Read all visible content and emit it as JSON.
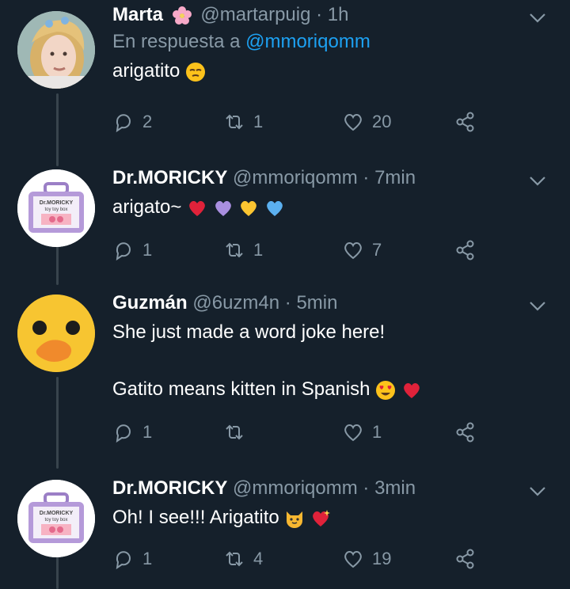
{
  "tweets": [
    {
      "name": "Marta",
      "name_emoji": "cherry-blossom",
      "handle": "@martarpuig",
      "time": "1h",
      "reply_prefix": "En respuesta a",
      "reply_mention": "@mmoriqomm",
      "text": "arigatito",
      "text_emoji": [
        "pensive-face"
      ],
      "replies": "2",
      "retweets": "1",
      "likes": "20"
    },
    {
      "name": "Dr.MORICKY",
      "handle": "@mmoriqomm",
      "time": "7min",
      "text": "arigato~",
      "text_emoji": [
        "red-heart",
        "purple-heart",
        "yellow-heart",
        "blue-heart"
      ],
      "replies": "1",
      "retweets": "1",
      "likes": "7"
    },
    {
      "name": "Guzmán",
      "handle": "@6uzm4n",
      "time": "5min",
      "text_lines": [
        "She just made a word joke here!",
        "Gatito means kitten in Spanish"
      ],
      "text_emoji": [
        "heart-eyes-face",
        "red-heart"
      ],
      "replies": "1",
      "retweets": "",
      "likes": "1"
    },
    {
      "name": "Dr.MORICKY",
      "handle": "@mmoriqomm",
      "time": "3min",
      "text": "Oh! I see!!! Arigatito",
      "text_emoji": [
        "cat-face",
        "sparkling-heart"
      ],
      "replies": "1",
      "retweets": "4",
      "likes": "19"
    }
  ],
  "avatar_label": {
    "line1": "Dr.MORICKY",
    "line2": "toy toy box"
  },
  "colors": {
    "background": "#15202b",
    "secondary_text": "#8899a6",
    "link": "#1da1f2",
    "thread_line": "#38444d"
  }
}
